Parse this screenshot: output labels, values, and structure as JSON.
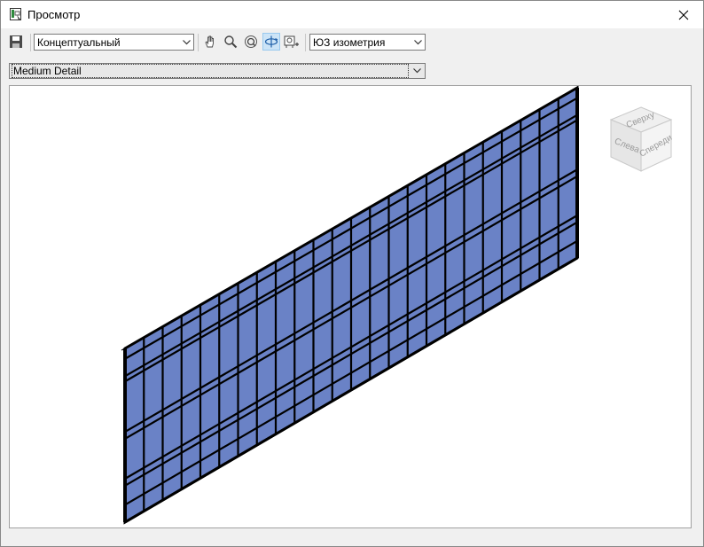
{
  "window": {
    "title": "Просмотр"
  },
  "toolbar": {
    "visual_style": "Концептуальный",
    "view": "ЮЗ изометрия",
    "icons": [
      "save-icon",
      "pan-icon",
      "zoom-icon",
      "zoom-extents-icon",
      "orbit-icon",
      "camera-icon"
    ]
  },
  "detail_level": "Medium Detail",
  "viewcube": {
    "top": "Сверху",
    "left": "Слева",
    "front": "Спереди"
  },
  "model": {
    "element": "curtain-wall",
    "panel_color": "#6a82c6",
    "mullion_color": "#000000",
    "vertical_divisions": 24,
    "horizontal_mullion_fractions": [
      0.06,
      0.16,
      0.19,
      0.48,
      0.52,
      0.75,
      0.79,
      0.9
    ]
  }
}
